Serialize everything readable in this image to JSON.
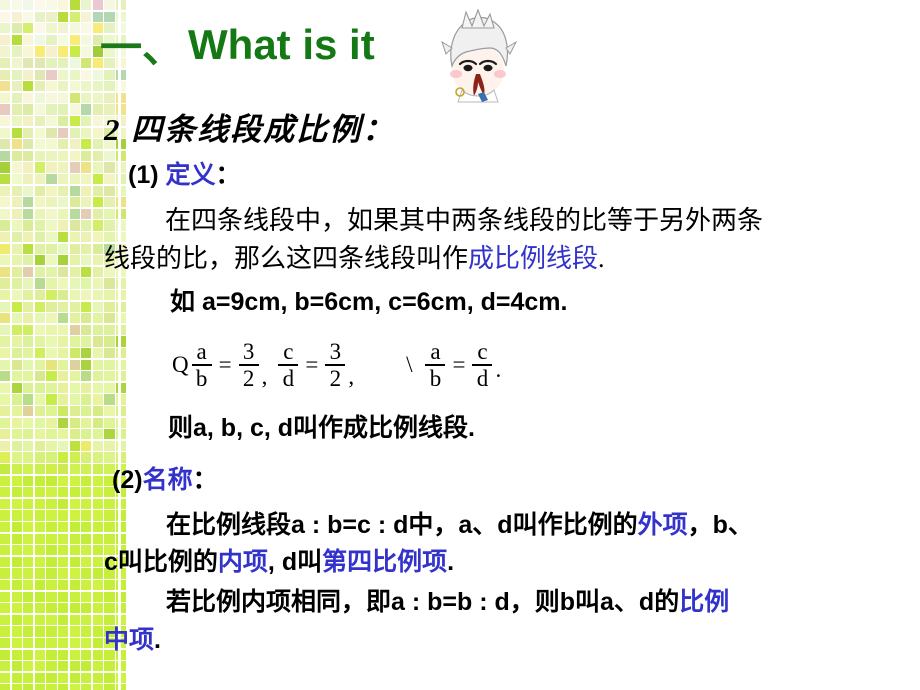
{
  "slide": {
    "title": {
      "prefix": "一、",
      "english": "What is it"
    },
    "heading": "2 四条线段成比例：",
    "sections": [
      {
        "marker": "(1) ",
        "label": "定义",
        "colon": "："
      },
      {
        "marker": "(2)",
        "label": "名称",
        "colon": "："
      }
    ],
    "definition": {
      "line1": "在四条线段中，如果其中两条线段的比等于另外两条",
      "line2_a": "线段的比，那么这四条线段叫作",
      "line2_highlight": "成比例线段",
      "line2_b": "."
    },
    "example": "如 a=9cm, b=6cm, c=6cm, d=4cm.",
    "conclusion": "则a, b, c, d叫作成比例线段.",
    "naming": {
      "line1_a": "在比例线段a : b=c : d中，",
      "line1_b": "a、d叫作比例的",
      "line1_highlight": "外项",
      "line1_c": "，b、",
      "line2_a": "c叫比例的",
      "line2_highlight1": "内项",
      "line2_b": ", d叫",
      "line2_highlight2": "第四比例项",
      "line2_c": ".",
      "line3_a": "若比例内项相同，即a : b=b : d，则b叫a、d的",
      "line3_highlight": "比例",
      "line4_highlight": "中项",
      "line4_b": "."
    },
    "formula": {
      "because": "Q",
      "frac1_num": "a",
      "frac1_den": "b",
      "eq1": "=",
      "frac2_num": "3",
      "frac2_den": "2",
      "comma1": ",",
      "frac3_num": "c",
      "frac3_den": "d",
      "eq2": "=",
      "frac4_num": "3",
      "frac4_den": "2",
      "comma2": ",",
      "therefore": "\\",
      "frac5_num": "a",
      "frac5_den": "b",
      "eq3": "=",
      "frac6_num": "c",
      "frac6_den": "d",
      "period": "."
    },
    "colors": {
      "title_green": "#1a7a1a",
      "highlight_blue": "#3333cc",
      "body_black": "#000000",
      "mosaic_green": "#c8f03c"
    }
  }
}
